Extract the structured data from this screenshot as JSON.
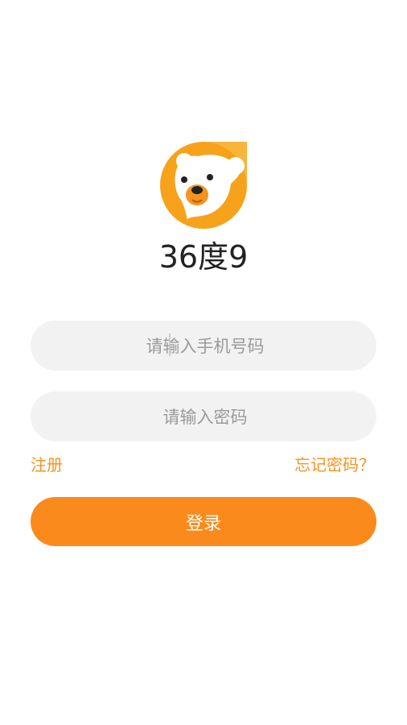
{
  "app": {
    "name": "36度9",
    "logo": "bear-logo-icon"
  },
  "form": {
    "phone_placeholder": "请输入手机号码",
    "phone_value": "",
    "password_placeholder": "请输入密码",
    "password_value": ""
  },
  "links": {
    "register": "注册",
    "forgot_password": "忘记密码？"
  },
  "login_button": "登录",
  "colors": {
    "accent": "#fb8a1c",
    "link": "#f7931e",
    "field_background": "#f2f2f2",
    "placeholder": "#9a9a9a",
    "title": "#222222"
  }
}
